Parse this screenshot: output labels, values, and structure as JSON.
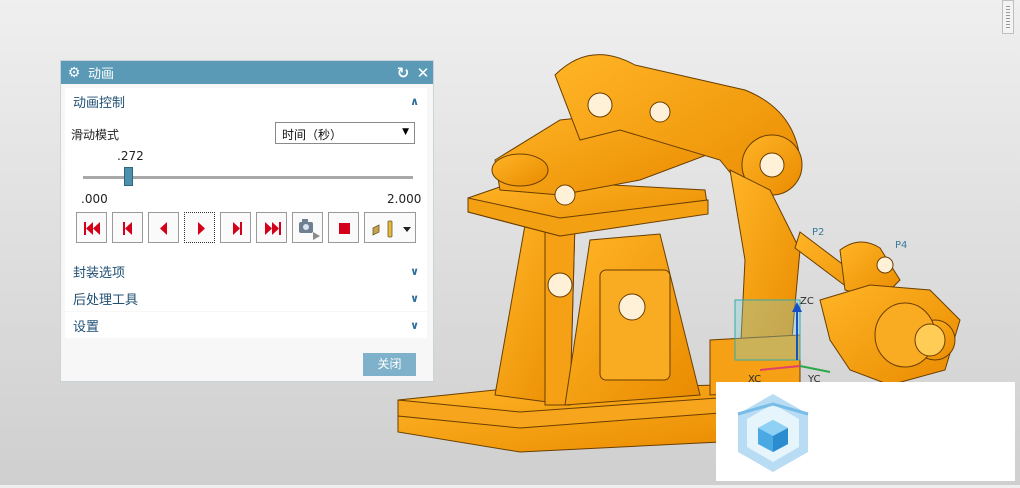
{
  "dialog": {
    "title": "动画",
    "icons": {
      "settings": "gear-icon",
      "reset": "reset-icon",
      "close": "close-icon"
    }
  },
  "animation_control": {
    "header": "动画控制",
    "mode_label": "滑动模式",
    "mode_value": "时间（秒）",
    "slider": {
      "current_label": ".272",
      "min_label": ".000",
      "max_label": "2.000",
      "position_fraction": 0.136
    },
    "buttons": [
      {
        "name": "first-frame-button",
        "icon": "skip-to-start-icon"
      },
      {
        "name": "step-back-button",
        "icon": "step-back-icon"
      },
      {
        "name": "play-backward-button",
        "icon": "play-backward-icon"
      },
      {
        "name": "play-forward-button",
        "icon": "play-forward-icon"
      },
      {
        "name": "step-forward-button",
        "icon": "step-forward-icon"
      },
      {
        "name": "last-frame-button",
        "icon": "skip-to-end-icon"
      },
      {
        "name": "record-button",
        "icon": "camera-icon"
      },
      {
        "name": "stop-button",
        "icon": "stop-icon"
      },
      {
        "name": "loop-mode-dropdown",
        "icon": "loop-mode-icon"
      }
    ]
  },
  "sections": {
    "packaging": "封装选项",
    "post_processing": "后处理工具",
    "settings": "设置"
  },
  "close_button": "关闭",
  "viewport_labels": {
    "zc": "ZC",
    "xc": "XC",
    "yc": "YC",
    "p2": "P2",
    "p4": "P4"
  },
  "colors": {
    "title_bar": "#5a9ab6",
    "model": "#f39a00",
    "close_btn": "#7fb2ca",
    "red": "#d4001a"
  }
}
